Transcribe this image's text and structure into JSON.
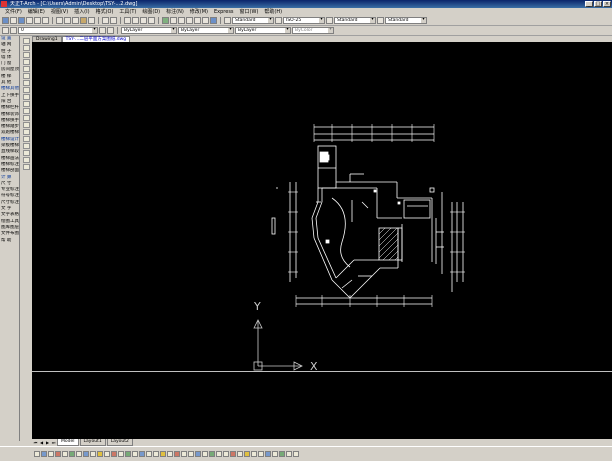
{
  "window": {
    "title": "天正T-Arch - [C:\\Users\\Admin\\Desktop\\TSY-...2.dwg]",
    "controls": {
      "minimize": "_",
      "maximize": "□",
      "close": "×"
    }
  },
  "menu": [
    "文件(F)",
    "编辑(E)",
    "视图(V)",
    "插入(I)",
    "格式(O)",
    "工具(T)",
    "绘图(D)",
    "标注(N)",
    "修改(M)",
    "Express",
    "窗口(W)",
    "帮助(H)"
  ],
  "toolbar_row1": {
    "text_style": "Standard",
    "dim_style": "ISO-25",
    "table_style": "Standard",
    "multileader_style": "Standard"
  },
  "toolbar_row2": {
    "layer": "0",
    "color": "ByLayer",
    "linetype": "ByLayer",
    "lineweight": "ByLayer",
    "plotstyle": "ByColor"
  },
  "left_panel": {
    "items": [
      {
        "label": "设 置",
        "head": true
      },
      {
        "label": "轴 网",
        "head": false
      },
      {
        "label": "柱 子",
        "head": false
      },
      {
        "label": "墙 体",
        "head": false
      },
      {
        "label": "门 窗",
        "head": false
      },
      {
        "label": "房间屋顶",
        "head": false
      },
      {
        "label": "楼 梯",
        "head": false
      },
      {
        "label": "其 他",
        "head": false
      },
      {
        "label": "楼梯其他",
        "head": true
      },
      {
        "label": "上下扶手",
        "head": false
      },
      {
        "label": "阳 台",
        "head": false
      },
      {
        "label": "楼梯栏杆",
        "head": false
      },
      {
        "label": "楼梯装饰",
        "head": false
      },
      {
        "label": "楼梯扶手",
        "head": false
      },
      {
        "label": "楼梯踏步",
        "head": false
      },
      {
        "label": "双跑楼梯",
        "head": false
      },
      {
        "label": "楼梯设计",
        "head": true
      },
      {
        "label": "梁板楼梯",
        "head": false
      },
      {
        "label": "直线梯段",
        "head": false
      },
      {
        "label": "楼梯画法",
        "head": false
      },
      {
        "label": "楼梯标注",
        "head": false
      },
      {
        "label": "楼梯剖面",
        "head": false
      },
      {
        "label": "计 算",
        "head": true
      },
      {
        "label": "尺 寸",
        "head": false
      },
      {
        "label": "专业标注",
        "head": false
      },
      {
        "label": "符号标注",
        "head": false
      },
      {
        "label": "尺寸标注",
        "head": false
      },
      {
        "label": "文 字",
        "head": false
      },
      {
        "label": "文字表格",
        "head": false
      },
      {
        "label": "绘图工具",
        "head": false
      },
      {
        "label": "图库图层",
        "head": false
      },
      {
        "label": "文件布图",
        "head": false
      },
      {
        "label": "帮 助",
        "head": false
      }
    ]
  },
  "document_tabs": [
    {
      "label": "Drawing1",
      "active": false
    },
    {
      "label": "TSY-...二层平面方案图纸.dwg",
      "active": true
    }
  ],
  "layout_tabs": [
    {
      "label": "Model",
      "active": true
    },
    {
      "label": "Layout1",
      "active": false
    },
    {
      "label": "Layout2",
      "active": false
    }
  ],
  "ucs": {
    "x_label": "X",
    "y_label": "Y"
  }
}
